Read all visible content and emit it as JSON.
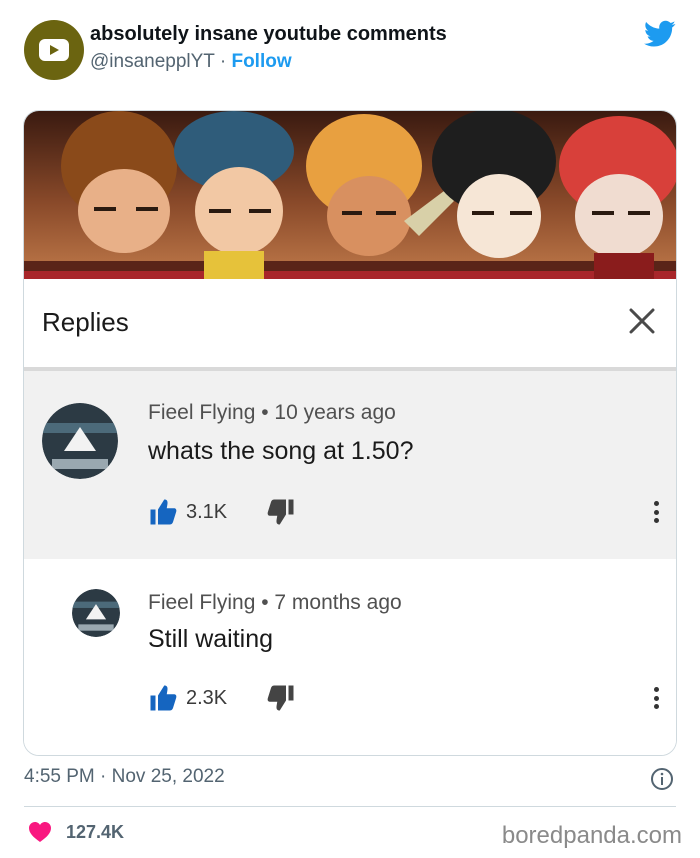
{
  "tweet": {
    "account_name": "absolutely insane youtube comments",
    "handle": "@insanepplYT",
    "separator": "·",
    "follow_label": "Follow",
    "timestamp": "4:55 PM · Nov 25, 2022",
    "likes": "127.4K",
    "colors": {
      "accent": "#1d9bf0",
      "heart": "#f91880",
      "avatar_bg": "#6b6410"
    }
  },
  "embedded": {
    "panel_title": "Replies",
    "comments": [
      {
        "author": "Fieel Flying",
        "dot": "•",
        "age": "10 years ago",
        "text": "whats the song at 1.50?",
        "likes": "3.1K"
      },
      {
        "author": "Fieel Flying",
        "dot": "•",
        "age": "7 months ago",
        "text": "Still waiting",
        "likes": "2.3K"
      }
    ],
    "icons": [
      "close-icon",
      "thumbs-up-icon",
      "thumbs-down-icon",
      "more-vert-icon"
    ]
  },
  "watermark": "boredpanda.com"
}
